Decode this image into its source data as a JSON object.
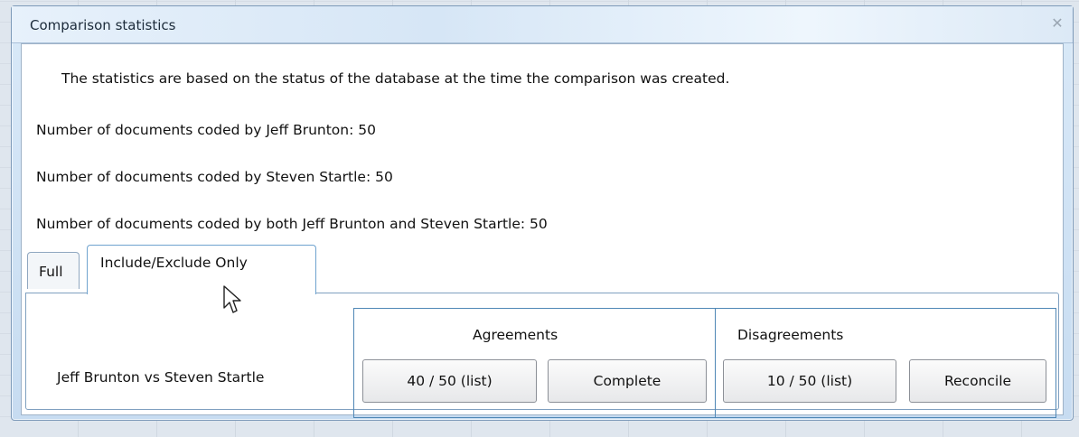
{
  "dialog": {
    "title": "Comparison statistics",
    "close_icon": "close-icon"
  },
  "info": {
    "note": "The statistics are based on the status of the database at the time the comparison was created.",
    "coder1_count": "Number of documents coded by Jeff Brunton: 50",
    "coder2_count": "Number of documents coded by Steven Startle: 50",
    "both_count": "Number of documents coded by both Jeff Brunton and Steven Startle: 50"
  },
  "tabs": [
    {
      "label": "Full",
      "selected": false
    },
    {
      "label": "Include/Exclude Only",
      "selected": true
    }
  ],
  "table": {
    "agreements_header": "Agreements",
    "disagreements_header": "Disagreements",
    "row_label": "Jeff Brunton vs Steven Startle",
    "agree_list_button": "40 / 50 (list)",
    "complete_button": "Complete",
    "disagree_list_button": "10 / 50 (list)",
    "reconcile_button": "Reconcile"
  },
  "colors": {
    "title_bar": "#d6e6f6",
    "frame_border": "#7d9ab9",
    "table_border": "#4f87b6"
  }
}
